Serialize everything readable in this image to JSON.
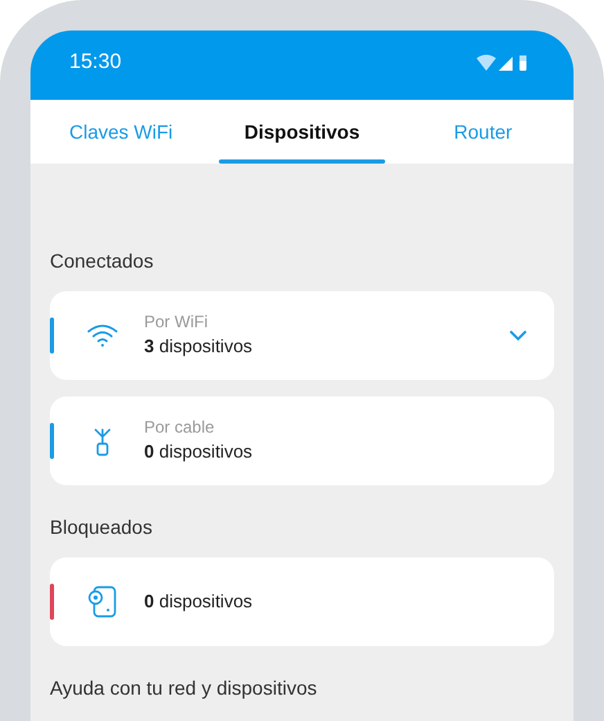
{
  "status_bar": {
    "time": "15:30"
  },
  "tabs": [
    {
      "label": "Claves WiFi",
      "selected": false
    },
    {
      "label": "Dispositivos",
      "selected": true
    },
    {
      "label": "Router",
      "selected": false
    }
  ],
  "sections": [
    {
      "title": "Conectados",
      "cards": [
        {
          "kind": "wifi",
          "color": "#1a9be6",
          "label": "Por WiFi",
          "count": "**3** dispositivos",
          "expandable": true
        },
        {
          "kind": "cable",
          "color": "#1a9be6",
          "label": "Por cable",
          "count": "**0** dispositivos",
          "expandable": false
        }
      ]
    },
    {
      "title": "Bloqueados",
      "cards": [
        {
          "kind": "blocked",
          "color": "#e0455a",
          "count": "**0** dispositivos",
          "expandable": false
        }
      ]
    },
    {
      "title": "Ayuda con tu red y dispositivos"
    }
  ]
}
